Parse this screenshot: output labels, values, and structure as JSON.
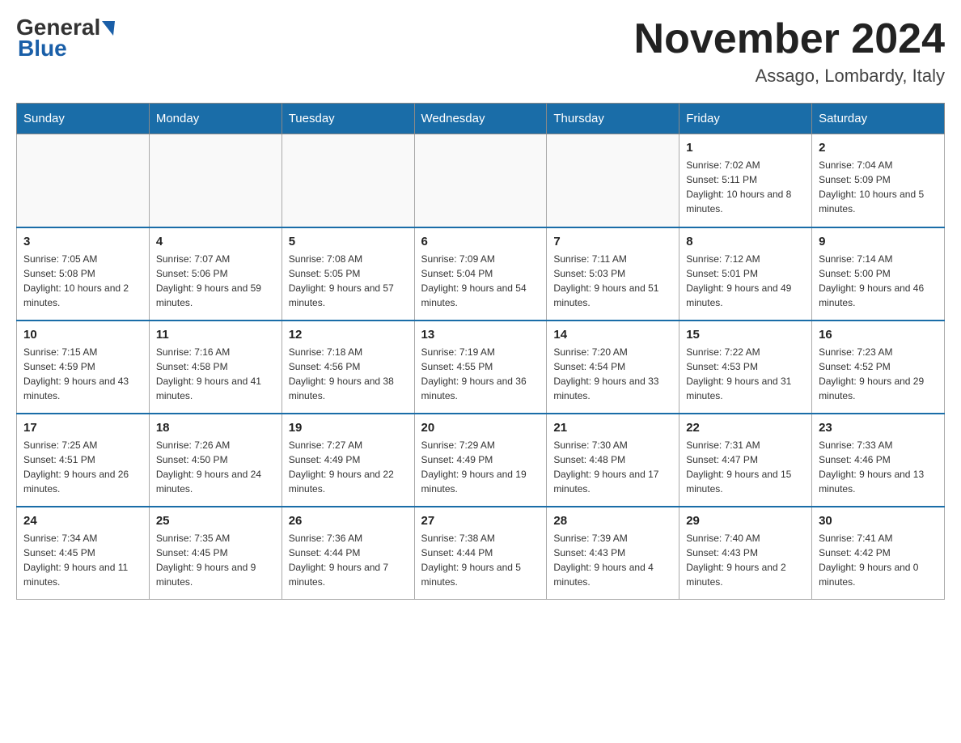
{
  "header": {
    "logo_main": "General",
    "logo_sub": "Blue",
    "title": "November 2024",
    "location": "Assago, Lombardy, Italy"
  },
  "days_of_week": [
    "Sunday",
    "Monday",
    "Tuesday",
    "Wednesday",
    "Thursday",
    "Friday",
    "Saturday"
  ],
  "weeks": [
    [
      {
        "day": "",
        "info": ""
      },
      {
        "day": "",
        "info": ""
      },
      {
        "day": "",
        "info": ""
      },
      {
        "day": "",
        "info": ""
      },
      {
        "day": "",
        "info": ""
      },
      {
        "day": "1",
        "info": "Sunrise: 7:02 AM\nSunset: 5:11 PM\nDaylight: 10 hours and 8 minutes."
      },
      {
        "day": "2",
        "info": "Sunrise: 7:04 AM\nSunset: 5:09 PM\nDaylight: 10 hours and 5 minutes."
      }
    ],
    [
      {
        "day": "3",
        "info": "Sunrise: 7:05 AM\nSunset: 5:08 PM\nDaylight: 10 hours and 2 minutes."
      },
      {
        "day": "4",
        "info": "Sunrise: 7:07 AM\nSunset: 5:06 PM\nDaylight: 9 hours and 59 minutes."
      },
      {
        "day": "5",
        "info": "Sunrise: 7:08 AM\nSunset: 5:05 PM\nDaylight: 9 hours and 57 minutes."
      },
      {
        "day": "6",
        "info": "Sunrise: 7:09 AM\nSunset: 5:04 PM\nDaylight: 9 hours and 54 minutes."
      },
      {
        "day": "7",
        "info": "Sunrise: 7:11 AM\nSunset: 5:03 PM\nDaylight: 9 hours and 51 minutes."
      },
      {
        "day": "8",
        "info": "Sunrise: 7:12 AM\nSunset: 5:01 PM\nDaylight: 9 hours and 49 minutes."
      },
      {
        "day": "9",
        "info": "Sunrise: 7:14 AM\nSunset: 5:00 PM\nDaylight: 9 hours and 46 minutes."
      }
    ],
    [
      {
        "day": "10",
        "info": "Sunrise: 7:15 AM\nSunset: 4:59 PM\nDaylight: 9 hours and 43 minutes."
      },
      {
        "day": "11",
        "info": "Sunrise: 7:16 AM\nSunset: 4:58 PM\nDaylight: 9 hours and 41 minutes."
      },
      {
        "day": "12",
        "info": "Sunrise: 7:18 AM\nSunset: 4:56 PM\nDaylight: 9 hours and 38 minutes."
      },
      {
        "day": "13",
        "info": "Sunrise: 7:19 AM\nSunset: 4:55 PM\nDaylight: 9 hours and 36 minutes."
      },
      {
        "day": "14",
        "info": "Sunrise: 7:20 AM\nSunset: 4:54 PM\nDaylight: 9 hours and 33 minutes."
      },
      {
        "day": "15",
        "info": "Sunrise: 7:22 AM\nSunset: 4:53 PM\nDaylight: 9 hours and 31 minutes."
      },
      {
        "day": "16",
        "info": "Sunrise: 7:23 AM\nSunset: 4:52 PM\nDaylight: 9 hours and 29 minutes."
      }
    ],
    [
      {
        "day": "17",
        "info": "Sunrise: 7:25 AM\nSunset: 4:51 PM\nDaylight: 9 hours and 26 minutes."
      },
      {
        "day": "18",
        "info": "Sunrise: 7:26 AM\nSunset: 4:50 PM\nDaylight: 9 hours and 24 minutes."
      },
      {
        "day": "19",
        "info": "Sunrise: 7:27 AM\nSunset: 4:49 PM\nDaylight: 9 hours and 22 minutes."
      },
      {
        "day": "20",
        "info": "Sunrise: 7:29 AM\nSunset: 4:49 PM\nDaylight: 9 hours and 19 minutes."
      },
      {
        "day": "21",
        "info": "Sunrise: 7:30 AM\nSunset: 4:48 PM\nDaylight: 9 hours and 17 minutes."
      },
      {
        "day": "22",
        "info": "Sunrise: 7:31 AM\nSunset: 4:47 PM\nDaylight: 9 hours and 15 minutes."
      },
      {
        "day": "23",
        "info": "Sunrise: 7:33 AM\nSunset: 4:46 PM\nDaylight: 9 hours and 13 minutes."
      }
    ],
    [
      {
        "day": "24",
        "info": "Sunrise: 7:34 AM\nSunset: 4:45 PM\nDaylight: 9 hours and 11 minutes."
      },
      {
        "day": "25",
        "info": "Sunrise: 7:35 AM\nSunset: 4:45 PM\nDaylight: 9 hours and 9 minutes."
      },
      {
        "day": "26",
        "info": "Sunrise: 7:36 AM\nSunset: 4:44 PM\nDaylight: 9 hours and 7 minutes."
      },
      {
        "day": "27",
        "info": "Sunrise: 7:38 AM\nSunset: 4:44 PM\nDaylight: 9 hours and 5 minutes."
      },
      {
        "day": "28",
        "info": "Sunrise: 7:39 AM\nSunset: 4:43 PM\nDaylight: 9 hours and 4 minutes."
      },
      {
        "day": "29",
        "info": "Sunrise: 7:40 AM\nSunset: 4:43 PM\nDaylight: 9 hours and 2 minutes."
      },
      {
        "day": "30",
        "info": "Sunrise: 7:41 AM\nSunset: 4:42 PM\nDaylight: 9 hours and 0 minutes."
      }
    ]
  ]
}
